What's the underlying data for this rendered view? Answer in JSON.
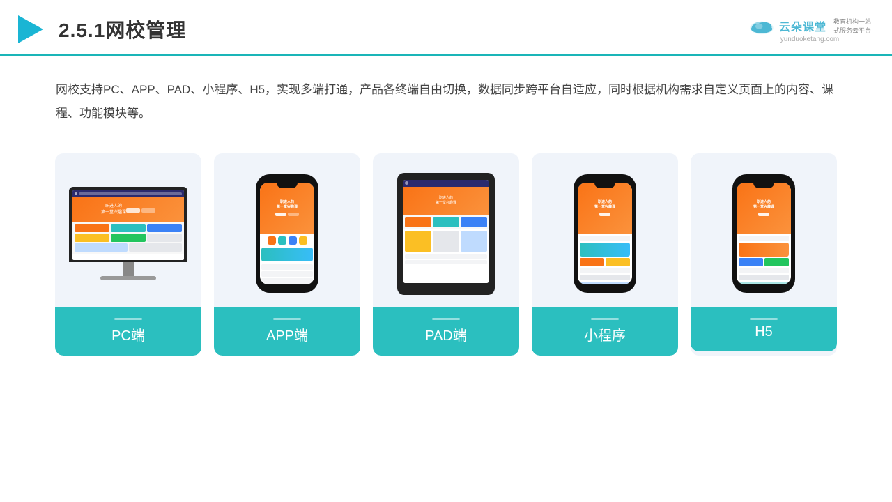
{
  "header": {
    "title": "2.5.1网校管理",
    "brand_name": "云朵课堂",
    "brand_url": "yunduoketang.com",
    "brand_slogan": "教育机构一站\n式服务云平台"
  },
  "description": {
    "text": "网校支持PC、APP、PAD、小程序、H5，实现多端打通，产品各终端自由切换，数据同步跨平台自适应，同时根据机构需求自定义页面上的内容、课程、功能模块等。"
  },
  "cards": [
    {
      "id": "pc",
      "label": "PC端",
      "type": "pc"
    },
    {
      "id": "app",
      "label": "APP端",
      "type": "phone"
    },
    {
      "id": "pad",
      "label": "PAD端",
      "type": "tablet"
    },
    {
      "id": "miniprogram",
      "label": "小程序",
      "type": "phone"
    },
    {
      "id": "h5",
      "label": "H5",
      "type": "phone"
    }
  ],
  "colors": {
    "accent": "#2bbfbf",
    "border_bottom": "#1ab5b8",
    "card_bg": "#f0f4fa",
    "text_main": "#444",
    "title_color": "#333"
  }
}
